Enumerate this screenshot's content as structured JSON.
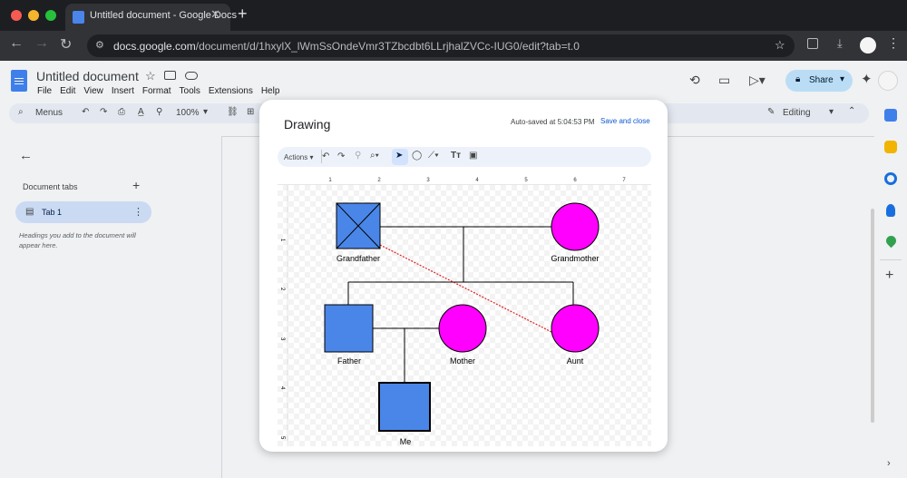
{
  "browser": {
    "tab_title": "Untitled document - Google Docs",
    "url_host": "docs.google.com",
    "url_path": "/document/d/1hxylX_lWmSsOndeVmr3TZbcdbt6LLrjhalZVCc-IUG0/edit?tab=t.0"
  },
  "docs": {
    "title": "Untitled document",
    "menu": [
      "File",
      "Edit",
      "View",
      "Insert",
      "Format",
      "Tools",
      "Extensions",
      "Help"
    ],
    "share_label": "Share",
    "toolbar": {
      "menus_label": "Menus",
      "zoom": "100%",
      "mode": "Editing"
    },
    "sidebar": {
      "heading": "Document tabs",
      "tab_label": "Tab 1",
      "hint": "Headings you add to the document will appear here."
    }
  },
  "drawing": {
    "title": "Drawing",
    "autosave": "Auto-saved at 5:04:53 PM",
    "save_close": "Save and close",
    "actions_label": "Actions",
    "ruler_top": [
      "1",
      "2",
      "3",
      "4",
      "5",
      "6",
      "7"
    ],
    "ruler_left": [
      "1",
      "2",
      "3",
      "4",
      "5"
    ],
    "people": {
      "grandfather": "Grandfather",
      "grandmother": "Grandmother",
      "father": "Father",
      "mother": "Mother",
      "aunt": "Aunt",
      "me": "Me"
    },
    "colors": {
      "male": "#4a86e8",
      "female": "#ff00ff",
      "dashed_line": "#e02020"
    }
  }
}
